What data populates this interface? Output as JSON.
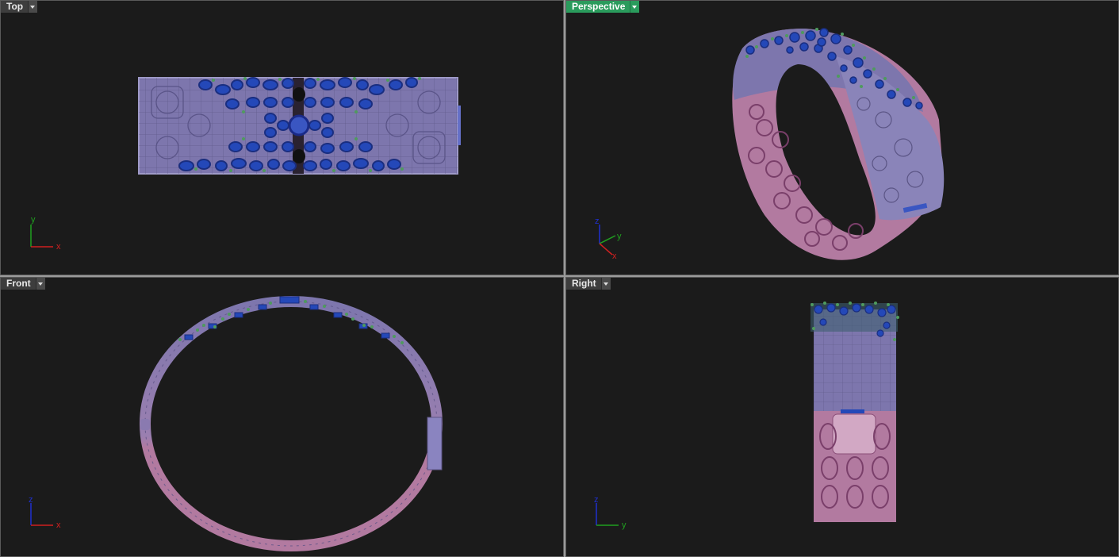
{
  "viewports": [
    {
      "id": "top",
      "label": "Top",
      "active": false,
      "axes": [
        "y",
        "x"
      ]
    },
    {
      "id": "perspective",
      "label": "Perspective",
      "active": true,
      "axes": [
        "z",
        "y",
        "x"
      ]
    },
    {
      "id": "front",
      "label": "Front",
      "active": false,
      "axes": [
        "z",
        "x"
      ]
    },
    {
      "id": "right",
      "label": "Right",
      "active": false,
      "axes": [
        "z",
        "y"
      ]
    }
  ],
  "colors": {
    "viewport_bg": "#1b1b1b",
    "active_tab": "#2a9b5c",
    "band_purple": "#7d76ad",
    "band_pink": "#b27aa0",
    "gem_blue": "#2448b8",
    "prong_green": "#4f9a5e",
    "axis_x": "#d02020",
    "axis_y": "#20a020",
    "axis_z": "#2030d0"
  },
  "icons": {
    "viewport_menu": "chevron-down-icon"
  }
}
